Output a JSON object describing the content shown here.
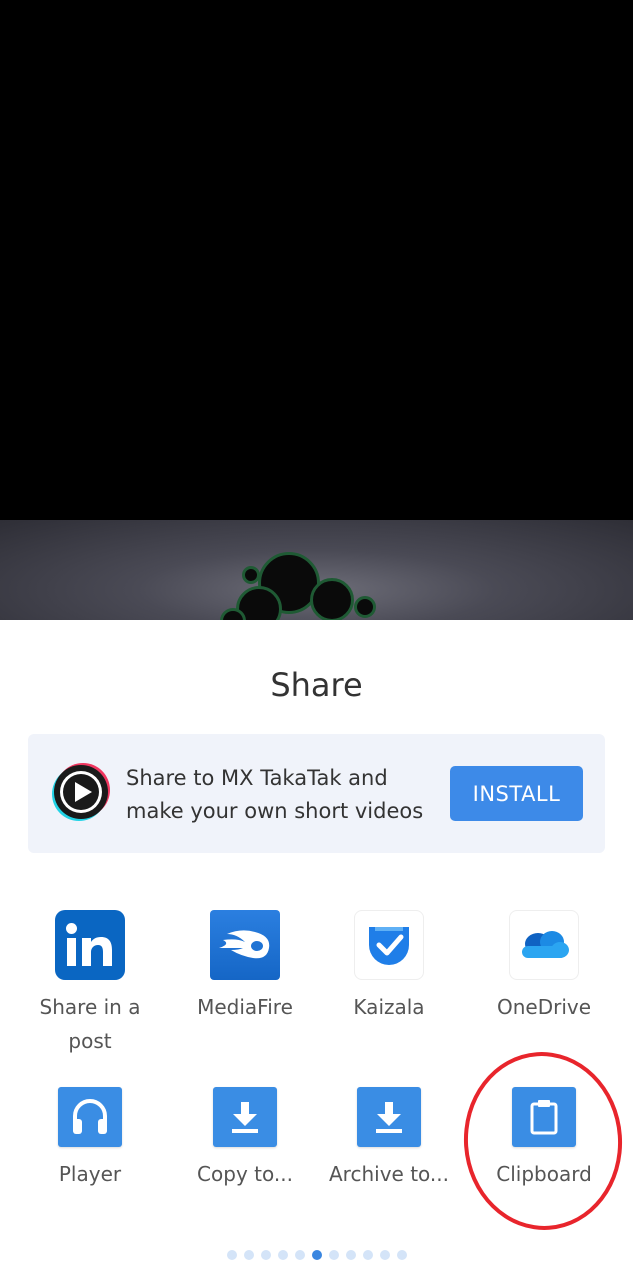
{
  "share_sheet": {
    "title": "Share",
    "promo": {
      "text": "Share to MX TakaTak and make your own short videos",
      "install_label": "INSTALL"
    },
    "apps_row1": [
      {
        "label": "Share in a post",
        "icon": "linkedin-icon"
      },
      {
        "label": "MediaFire",
        "icon": "mediafire-icon"
      },
      {
        "label": "Kaizala",
        "icon": "kaizala-icon"
      },
      {
        "label": "OneDrive",
        "icon": "onedrive-icon"
      }
    ],
    "apps_row2": [
      {
        "label": "Player",
        "icon": "headphones-icon"
      },
      {
        "label": "Copy to...",
        "icon": "download-icon"
      },
      {
        "label": "Archive to...",
        "icon": "download-icon"
      },
      {
        "label": "Clipboard",
        "icon": "clipboard-icon"
      }
    ],
    "page_indicator": {
      "total": 11,
      "active_index": 5
    }
  },
  "colors": {
    "accent": "#3d8ae8",
    "highlight_circle": "#e8252c",
    "promo_bg": "#f0f3fa"
  }
}
